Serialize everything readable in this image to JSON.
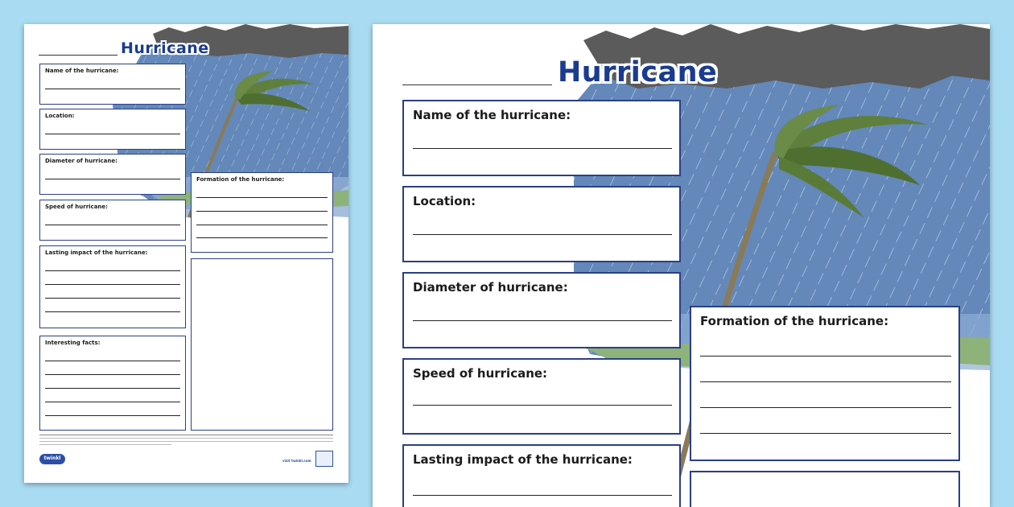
{
  "worksheet": {
    "title": "Hurricane",
    "boxes": {
      "name": "Name of the hurricane:",
      "location": "Location:",
      "diameter": "Diameter of hurricane:",
      "speed": "Speed of hurricane:",
      "impact": "Lasting impact of the hurricane:",
      "facts": "Interesting facts:",
      "formation": "Formation of the hurricane:"
    },
    "logo": "twinkl",
    "visit": "visit twinkl.com",
    "colors": {
      "background": "#a9dbf2",
      "title": "#1a3b8f",
      "box_border": "#2b3f86",
      "sky": "#5f86b8",
      "clouds": "#5a5a5a",
      "palm_leaves": "#5f7f3c",
      "grass": "#8fb17a"
    },
    "icons": [
      "palm-tree-illustration",
      "storm-cloud-illustration",
      "rain-illustration"
    ]
  }
}
